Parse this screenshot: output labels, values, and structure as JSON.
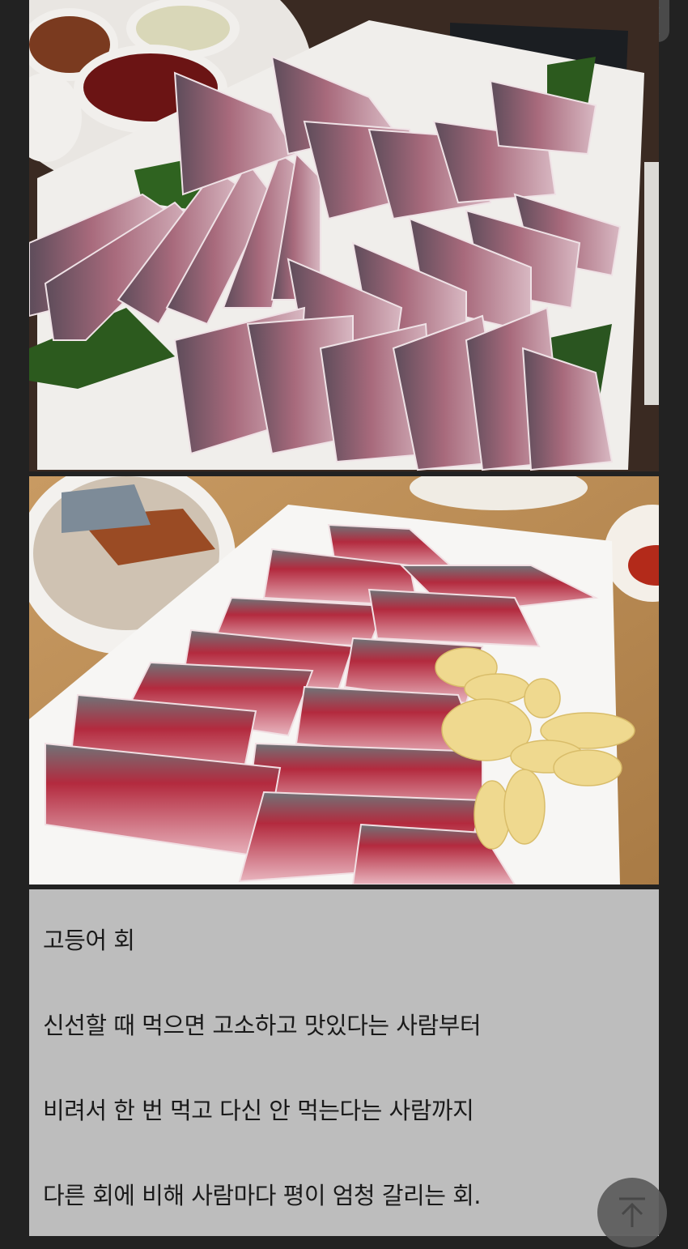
{
  "post": {
    "title": "고등어 회",
    "paragraphs": [
      "신선할 때 먹으면 고소하고 맛있다는 사람부터",
      "비려서 한 번 먹고 다신 안 먹는다는 사람까지",
      "다른 회에 비해 사람마다 평이 엄청 갈리는 회."
    ]
  },
  "images": [
    {
      "subject": "mackerel-sashimi-platter-perilla"
    },
    {
      "subject": "mackerel-sashimi-platter-garlic"
    }
  ],
  "controls": {
    "scroll_up_icon": "chevron-up-icon",
    "scroll_down_icon": "chevron-down-icon",
    "to_top_icon": "arrow-up-icon"
  },
  "colors": {
    "background": "#222222",
    "text_panel": "#bdbdbd",
    "text": "#1a1a1a",
    "button": "#5c5c5c"
  }
}
